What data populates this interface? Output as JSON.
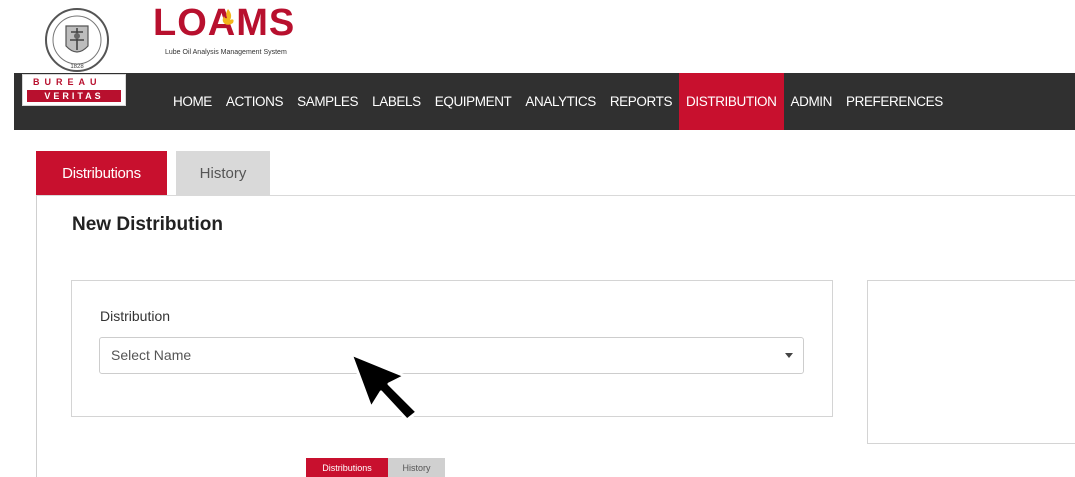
{
  "brand": {
    "product_name": "LOAMS",
    "product_tagline": "Lube Oil Analysis Management System",
    "company_top": "BUREAU",
    "company_bottom": "VERITAS",
    "seal_year": "1828",
    "brand_color": "#c8102e",
    "nav_background": "#303030"
  },
  "nav": {
    "items": [
      {
        "label": "HOME",
        "active": false
      },
      {
        "label": "ACTIONS",
        "active": false
      },
      {
        "label": "SAMPLES",
        "active": false
      },
      {
        "label": "LABELS",
        "active": false
      },
      {
        "label": "EQUIPMENT",
        "active": false
      },
      {
        "label": "ANALYTICS",
        "active": false
      },
      {
        "label": "REPORTS",
        "active": false
      },
      {
        "label": "DISTRIBUTION",
        "active": true
      },
      {
        "label": "ADMIN",
        "active": false
      },
      {
        "label": "PREFERENCES",
        "active": false
      }
    ]
  },
  "tabs": [
    {
      "label": "Distributions",
      "active": true
    },
    {
      "label": "History",
      "active": false
    }
  ],
  "main": {
    "title": "New Distribution",
    "distribution_field": {
      "label": "Distribution",
      "placeholder": "Select Name",
      "value": ""
    }
  },
  "caption_tabs": [
    {
      "label": "Distributions",
      "active": true
    },
    {
      "label": "History",
      "active": false
    }
  ],
  "icons": {
    "seal": "bureau-veritas-seal-icon",
    "flame": "flame-icon",
    "caret": "chevron-down-icon",
    "cursor": "mouse-pointer-icon"
  }
}
